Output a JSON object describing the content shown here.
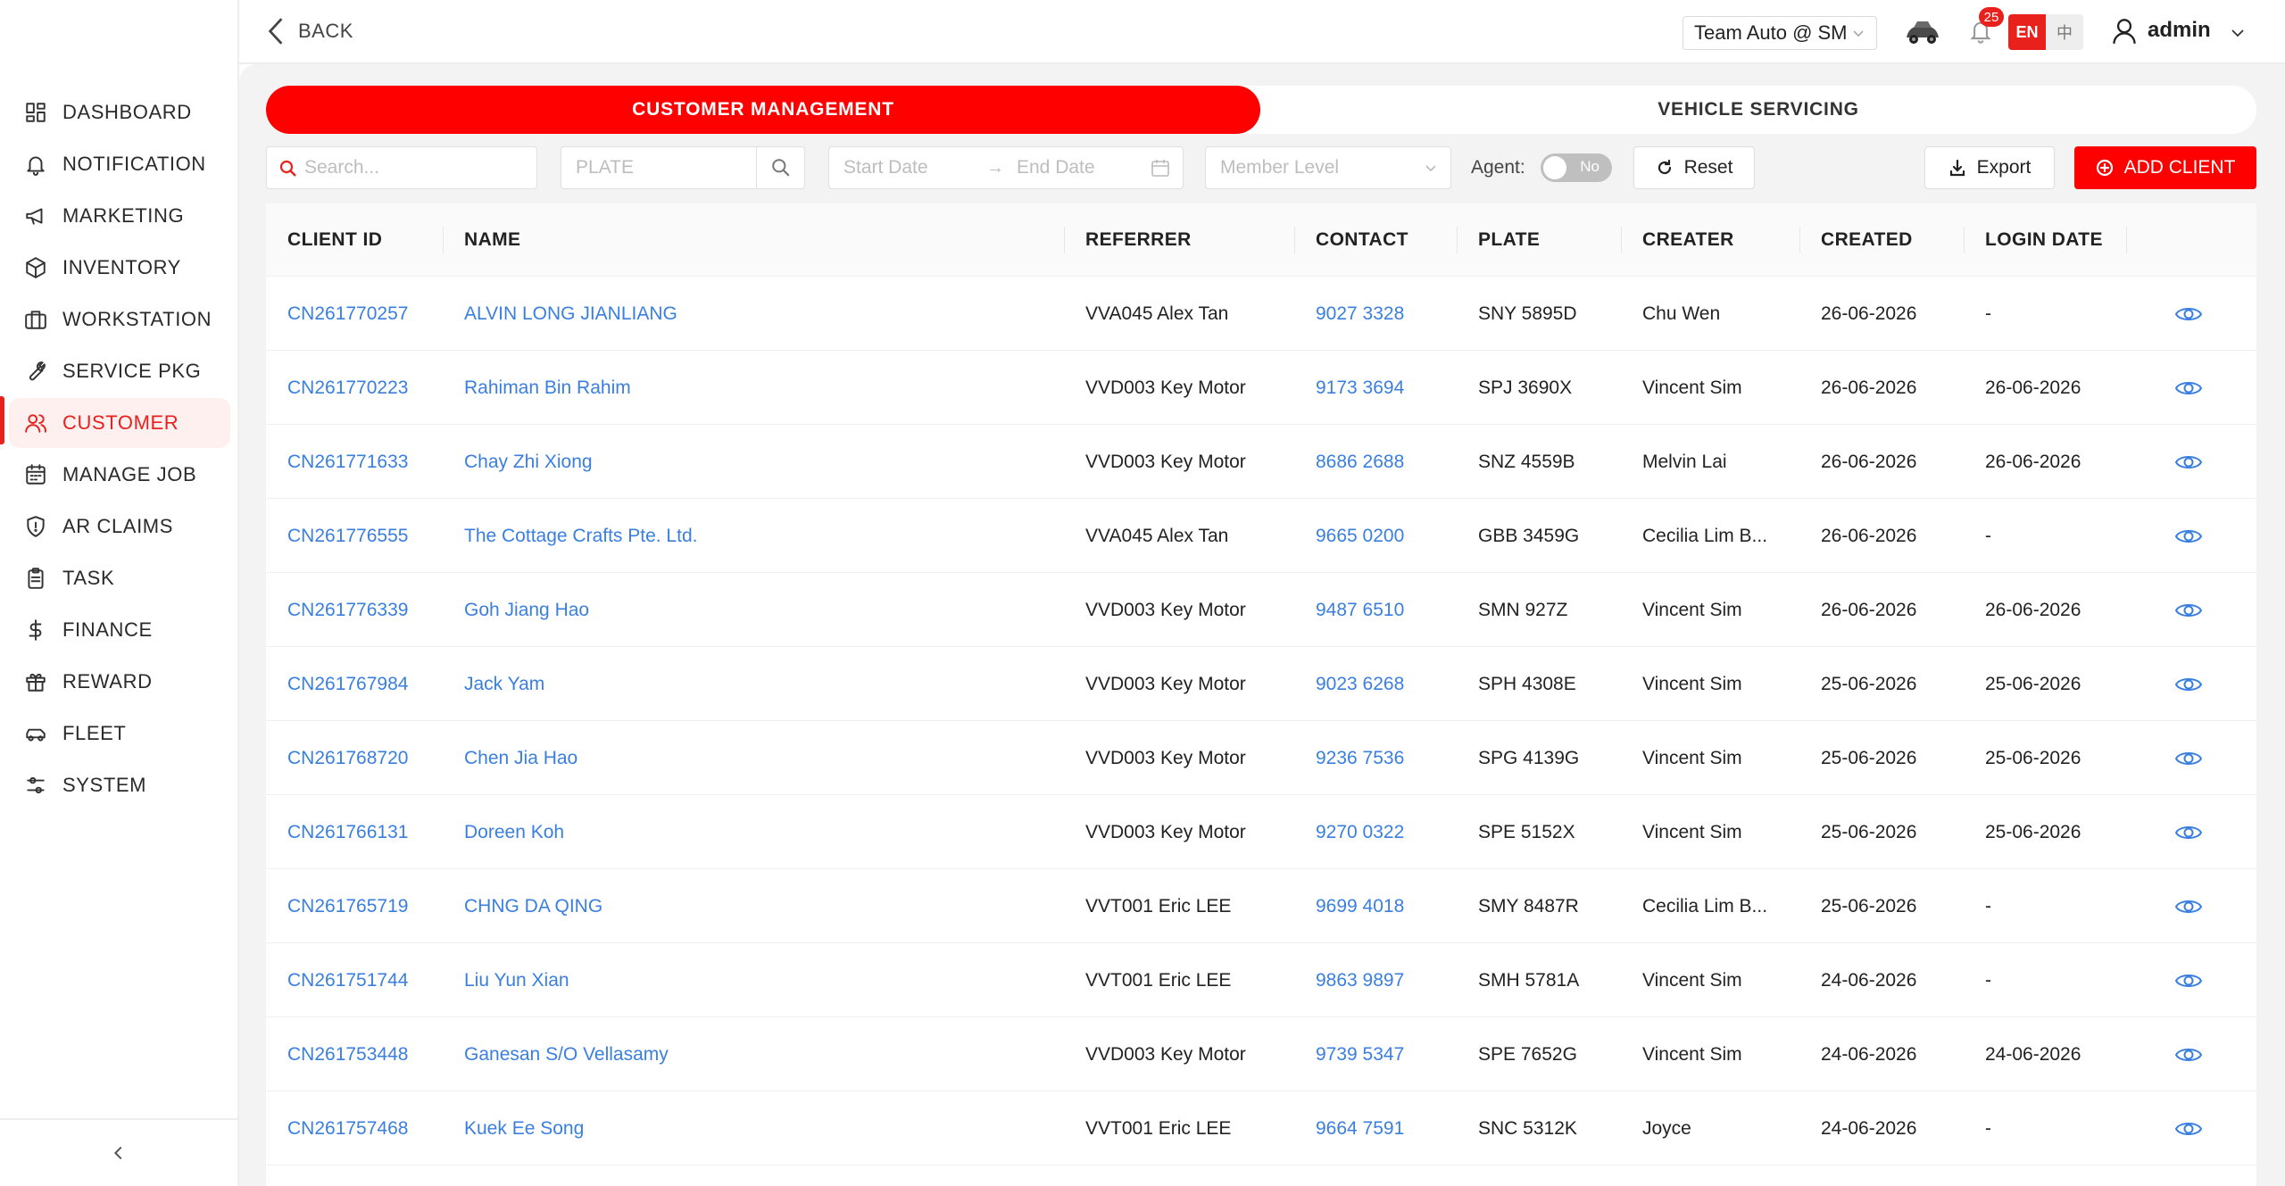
{
  "sidebar": {
    "items": [
      {
        "label": "DASHBOARD",
        "icon": "dashboard-icon"
      },
      {
        "label": "NOTIFICATION",
        "icon": "bell-icon"
      },
      {
        "label": "MARKETING",
        "icon": "megaphone-icon"
      },
      {
        "label": "INVENTORY",
        "icon": "box-icon"
      },
      {
        "label": "WORKSTATION",
        "icon": "briefcase-icon"
      },
      {
        "label": "SERVICE PKG",
        "icon": "wrench-icon"
      },
      {
        "label": "CUSTOMER",
        "icon": "users-icon"
      },
      {
        "label": "MANAGE JOB",
        "icon": "calendar-icon"
      },
      {
        "label": "AR CLAIMS",
        "icon": "shield-icon"
      },
      {
        "label": "TASK",
        "icon": "clipboard-icon"
      },
      {
        "label": "FINANCE",
        "icon": "dollar-icon"
      },
      {
        "label": "REWARD",
        "icon": "gift-icon"
      },
      {
        "label": "FLEET",
        "icon": "car-icon"
      },
      {
        "label": "SYSTEM",
        "icon": "sliders-icon"
      }
    ],
    "active": "CUSTOMER",
    "accent_color": "#e8211d"
  },
  "header": {
    "back_label": "BACK",
    "team": "Team Auto @ SM",
    "notification_count": "25",
    "lang_en": "EN",
    "lang_zh": "中",
    "user": "admin"
  },
  "tabs": {
    "customer_management": "CUSTOMER MANAGEMENT",
    "vehicle_servicing": "VEHICLE SERVICING",
    "active": "CUSTOMER MANAGEMENT"
  },
  "filters": {
    "search_placeholder": "Search...",
    "plate_placeholder": "PLATE",
    "start_date_placeholder": "Start Date",
    "end_date_placeholder": "End Date",
    "member_level_placeholder": "Member Level",
    "agent_label": "Agent:",
    "agent_toggle": "No",
    "reset_label": "Reset",
    "export_label": "Export",
    "add_client_label": "ADD CLIENT"
  },
  "table": {
    "columns": [
      "CLIENT ID",
      "NAME",
      "REFERRER",
      "CONTACT",
      "PLATE",
      "CREATER",
      "CREATED",
      "LOGIN DATE"
    ],
    "rows": [
      {
        "client_id": "CN261770257",
        "name": "ALVIN LONG JIANLIANG",
        "referrer": "VVA045 Alex Tan",
        "contact": "9027 3328",
        "plate": "SNY 5895D",
        "creater": "Chu Wen",
        "created": "26-06-2026",
        "login": "-"
      },
      {
        "client_id": "CN261770223",
        "name": "Rahiman Bin Rahim",
        "referrer": "VVD003 Key Motor",
        "contact": "9173 3694",
        "plate": "SPJ 3690X",
        "creater": "Vincent Sim",
        "created": "26-06-2026",
        "login": "26-06-2026"
      },
      {
        "client_id": "CN261771633",
        "name": "Chay Zhi Xiong",
        "referrer": "VVD003 Key Motor",
        "contact": "8686 2688",
        "plate": "SNZ 4559B",
        "creater": "Melvin Lai",
        "created": "26-06-2026",
        "login": "26-06-2026"
      },
      {
        "client_id": "CN261776555",
        "name": "The Cottage Crafts Pte. Ltd.",
        "referrer": "VVA045 Alex Tan",
        "contact": "9665 0200",
        "plate": "GBB 3459G",
        "creater": "Cecilia Lim B...",
        "created": "26-06-2026",
        "login": "-"
      },
      {
        "client_id": "CN261776339",
        "name": "Goh Jiang Hao",
        "referrer": "VVD003 Key Motor",
        "contact": "9487 6510",
        "plate": "SMN 927Z",
        "creater": "Vincent Sim",
        "created": "26-06-2026",
        "login": "26-06-2026"
      },
      {
        "client_id": "CN261767984",
        "name": "Jack Yam",
        "referrer": "VVD003 Key Motor",
        "contact": "9023 6268",
        "plate": "SPH 4308E",
        "creater": "Vincent Sim",
        "created": "25-06-2026",
        "login": "25-06-2026"
      },
      {
        "client_id": "CN261768720",
        "name": "Chen Jia Hao",
        "referrer": "VVD003 Key Motor",
        "contact": "9236 7536",
        "plate": "SPG 4139G",
        "creater": "Vincent Sim",
        "created": "25-06-2026",
        "login": "25-06-2026"
      },
      {
        "client_id": "CN261766131",
        "name": "Doreen Koh",
        "referrer": "VVD003 Key Motor",
        "contact": "9270 0322",
        "plate": "SPE 5152X",
        "creater": "Vincent Sim",
        "created": "25-06-2026",
        "login": "25-06-2026"
      },
      {
        "client_id": "CN261765719",
        "name": "CHNG DA QING",
        "referrer": "VVT001 Eric LEE",
        "contact": "9699 4018",
        "plate": "SMY 8487R",
        "creater": "Cecilia Lim B...",
        "created": "25-06-2026",
        "login": "-"
      },
      {
        "client_id": "CN261751744",
        "name": "Liu Yun Xian",
        "referrer": "VVT001 Eric LEE",
        "contact": "9863 9897",
        "plate": "SMH 5781A",
        "creater": "Vincent Sim",
        "created": "24-06-2026",
        "login": "-"
      },
      {
        "client_id": "CN261753448",
        "name": "Ganesan S/O Vellasamy",
        "referrer": "VVD003 Key Motor",
        "contact": "9739 5347",
        "plate": "SPE 7652G",
        "creater": "Vincent Sim",
        "created": "24-06-2026",
        "login": "24-06-2026"
      },
      {
        "client_id": "CN261757468",
        "name": "Kuek Ee Song",
        "referrer": "VVT001 Eric LEE",
        "contact": "9664 7591",
        "plate": "SNC 5312K",
        "creater": "Joyce",
        "created": "24-06-2026",
        "login": "-"
      }
    ],
    "row_action_icon": "eye-icon",
    "link_color": "#3a7fe0"
  }
}
